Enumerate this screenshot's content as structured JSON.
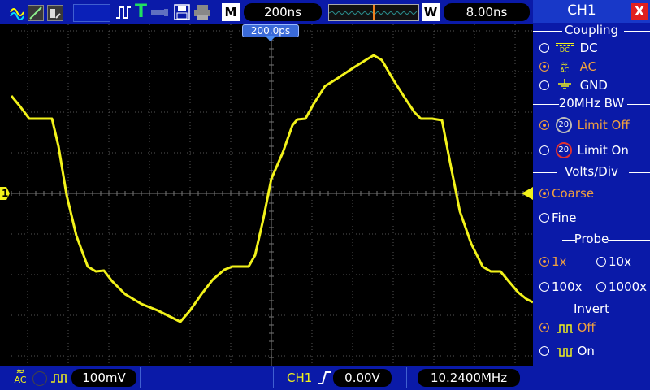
{
  "topbar": {
    "mode_label": "M",
    "timebase": "200ns",
    "window_label": "W",
    "window_timebase": "8.00ns",
    "trigger_position": "200.0ps"
  },
  "bottombar": {
    "coupling_symbol": "AC",
    "ch1_volts": "100mV",
    "trigger_channel": "CH1",
    "trigger_level": "0.00V",
    "frequency": "10.2400MHz"
  },
  "side": {
    "title": "CH1",
    "close": "X",
    "coupling": {
      "header": "Coupling",
      "options": [
        {
          "label": "DC",
          "icon_text": "DC",
          "selected": false
        },
        {
          "label": "AC",
          "icon_text": "AC",
          "selected": true
        },
        {
          "label": "GND",
          "icon_text": "",
          "selected": false
        }
      ]
    },
    "bw": {
      "header": "20MHz BW",
      "options": [
        {
          "label": "Limit Off",
          "icon_text": "20",
          "selected": true
        },
        {
          "label": "Limit On",
          "icon_text": "20",
          "selected": false
        }
      ]
    },
    "volts": {
      "header": "Volts/Div",
      "options": [
        {
          "label": "Coarse",
          "selected": true
        },
        {
          "label": "Fine",
          "selected": false
        }
      ]
    },
    "probe": {
      "header": "Probe",
      "options": [
        {
          "label": "1x",
          "selected": true
        },
        {
          "label": "10x",
          "selected": false
        },
        {
          "label": "100x",
          "selected": false
        },
        {
          "label": "1000x",
          "selected": false
        }
      ]
    },
    "invert": {
      "header": "Invert",
      "options": [
        {
          "label": "Off",
          "selected": true
        },
        {
          "label": "On",
          "selected": false
        }
      ]
    }
  },
  "marker": {
    "ch1_label": "1"
  },
  "colors": {
    "trace": "#f2f21a",
    "accent": "#f0a040",
    "bar": "#0a1aa8"
  }
}
